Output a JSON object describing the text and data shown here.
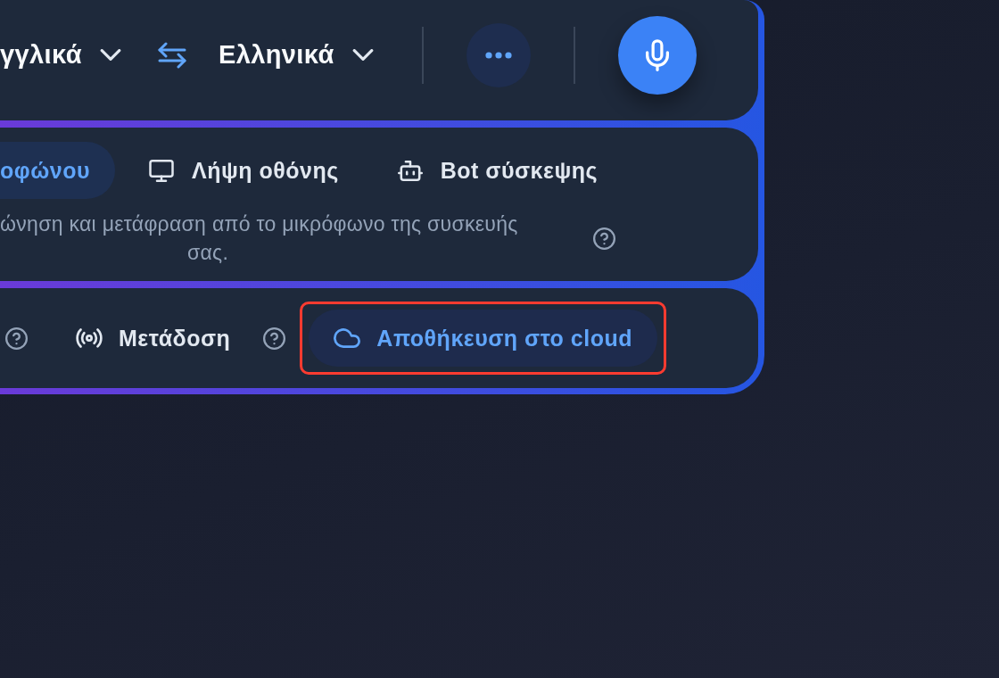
{
  "toolbar": {
    "source_language": "γγλικά",
    "target_language": "Ελληνικά"
  },
  "sources": {
    "tabs": [
      {
        "label": "οφώνου",
        "selected": true
      },
      {
        "label": "Λήψη οθόνης",
        "selected": false
      },
      {
        "label": "Bot σύσκεψης",
        "selected": false
      }
    ],
    "description": {
      "text": "ώνηση και μετάφραση από το μικρόφωνο της συσκευής σας.",
      "help": true
    }
  },
  "options": [
    {
      "help": true
    },
    {
      "label": "Μετάδοση",
      "on": false,
      "help": true
    },
    {
      "label": "Αποθήκευση στο cloud",
      "on": true,
      "help": false,
      "highlighted": true
    }
  ]
}
